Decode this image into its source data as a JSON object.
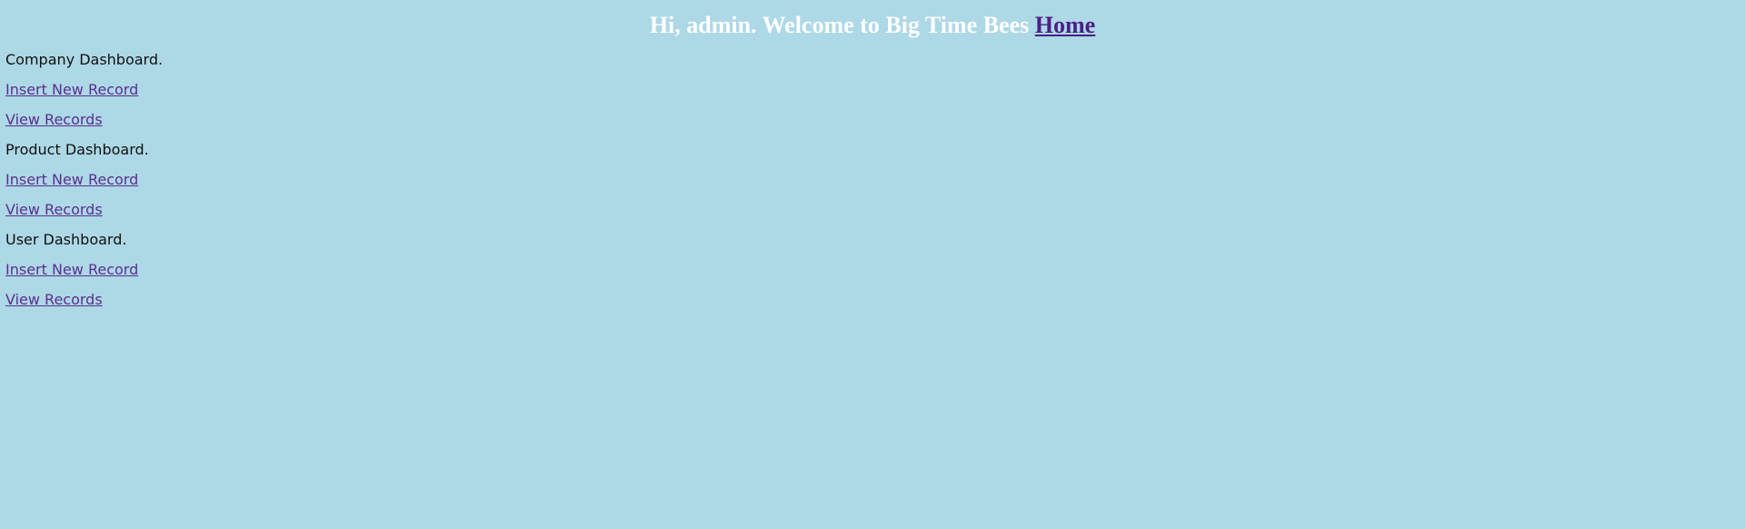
{
  "header": {
    "greeting": "Hi, admin. Welcome to Big Time Bees",
    "home_link": "Home"
  },
  "sections": [
    {
      "title": "Company Dashboard.",
      "insert_link": "Insert New Record",
      "view_link": "View Records"
    },
    {
      "title": "Product Dashboard.",
      "insert_link": "Insert New Record",
      "view_link": "View Records"
    },
    {
      "title": "User Dashboard.",
      "insert_link": "Insert New Record",
      "view_link": "View Records"
    }
  ],
  "colors": {
    "background": "#add8e6",
    "header_text": "#ffffff",
    "link": "#5b2f8f"
  }
}
